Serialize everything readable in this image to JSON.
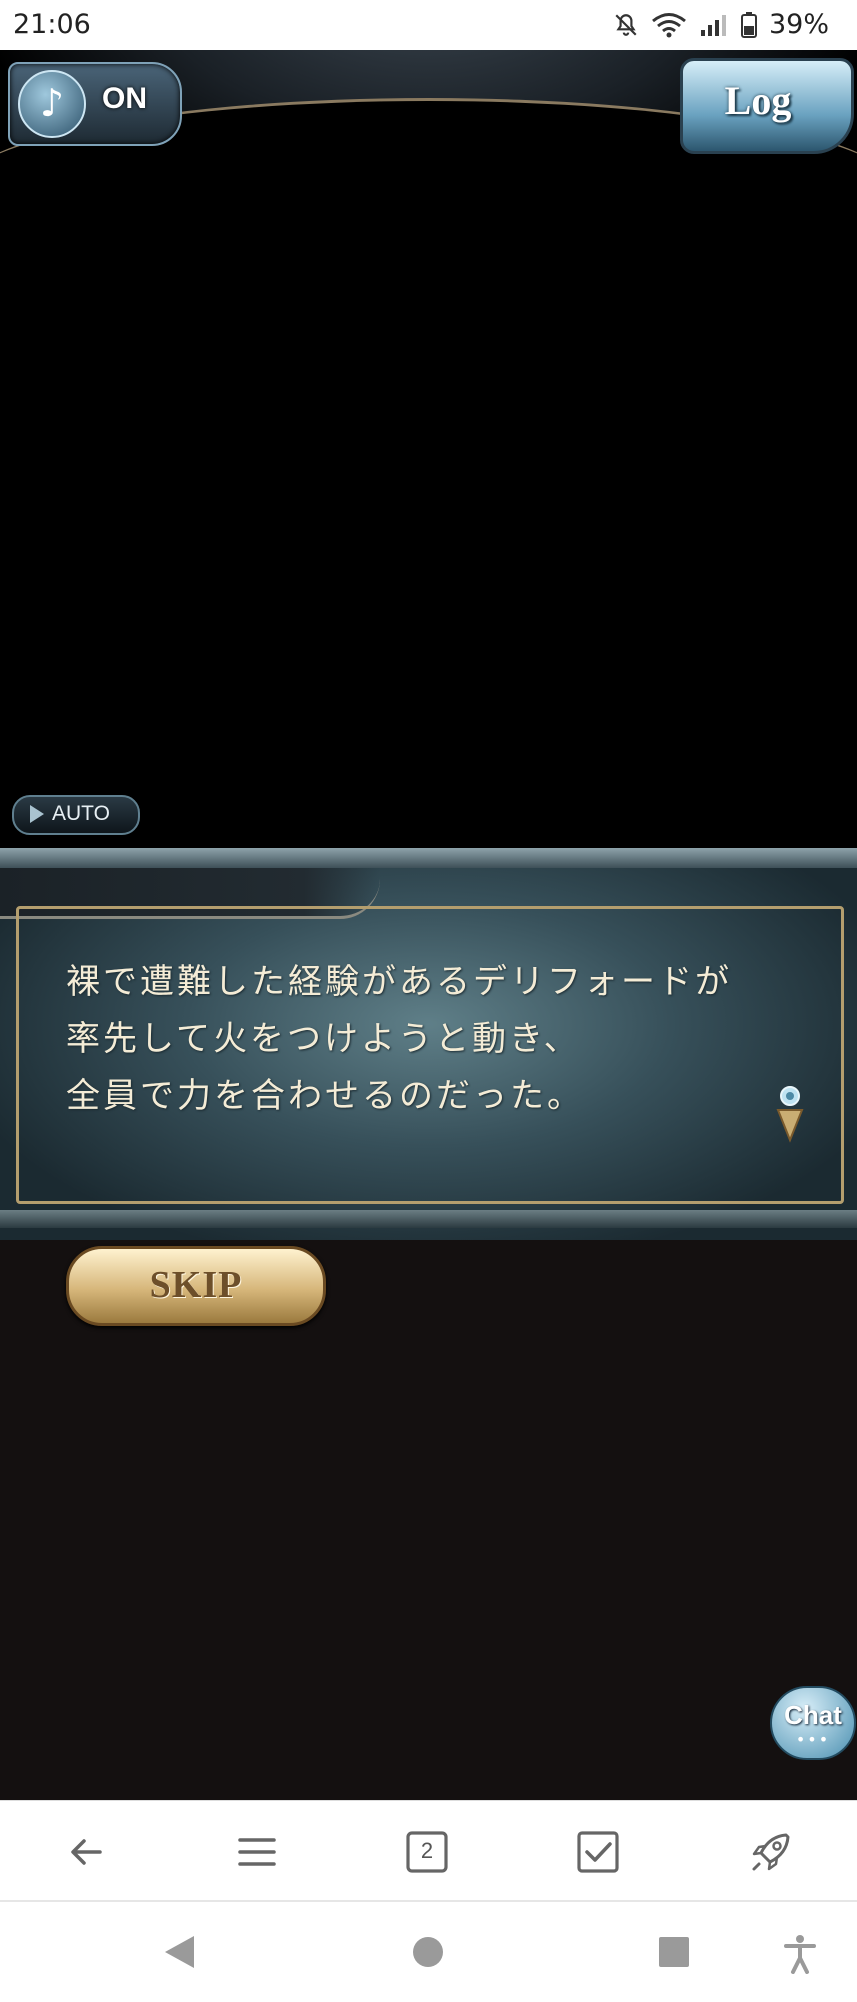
{
  "status_bar": {
    "time": "21:06",
    "battery": "39%",
    "icons": [
      "bell-off-icon",
      "wifi-icon",
      "signal-icon",
      "battery-icon"
    ]
  },
  "game": {
    "music_toggle": {
      "label": "ON",
      "icon": "music-note-icon"
    },
    "log_button": {
      "label": "Log"
    },
    "auto_button": {
      "label": "AUTO",
      "icon": "play-icon"
    },
    "dialog": {
      "lines": [
        "裸で遭難した経験があるデリフォードが",
        "率先して火をつけようと動き、",
        "全員で力を合わせるのだった。"
      ]
    },
    "skip_button": {
      "label": "SKIP"
    },
    "chat_button": {
      "label": "Chat",
      "dots": "•••"
    }
  },
  "browser_toolbar": {
    "tab_count": "2",
    "items": [
      "back-arrow-icon",
      "menu-icon",
      "tabs-icon",
      "checkbox-icon",
      "rocket-icon"
    ]
  },
  "system_nav": {
    "items": [
      "back-triangle-icon",
      "home-circle-icon",
      "recents-square-icon",
      "accessibility-icon"
    ]
  },
  "colors": {
    "dialog_text": "#f4ecd6",
    "frame_gold": "#b49e6e",
    "game_background": "#141010"
  }
}
